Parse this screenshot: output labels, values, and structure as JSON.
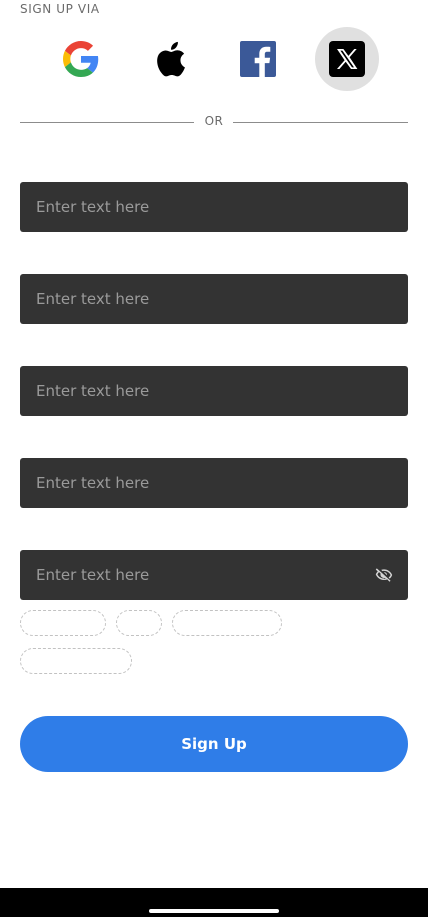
{
  "signup_via_label": "SIGN UP VIA",
  "social": [
    {
      "name": "google-icon"
    },
    {
      "name": "apple-icon"
    },
    {
      "name": "facebook-icon"
    },
    {
      "name": "x-icon",
      "selected": true
    }
  ],
  "divider_text": "OR",
  "fields": [
    {
      "placeholder": "Enter text here",
      "value": ""
    },
    {
      "placeholder": "Enter text here",
      "value": ""
    },
    {
      "placeholder": "Enter text here",
      "value": ""
    },
    {
      "placeholder": "Enter text here",
      "value": ""
    },
    {
      "placeholder": "Enter text here",
      "value": "",
      "icon": "eye-off-icon"
    }
  ],
  "submit_label": "Sign Up",
  "colors": {
    "accent": "#2f7de8",
    "field_bg": "#333333",
    "selected_social_bg": "#e0e0e0"
  }
}
